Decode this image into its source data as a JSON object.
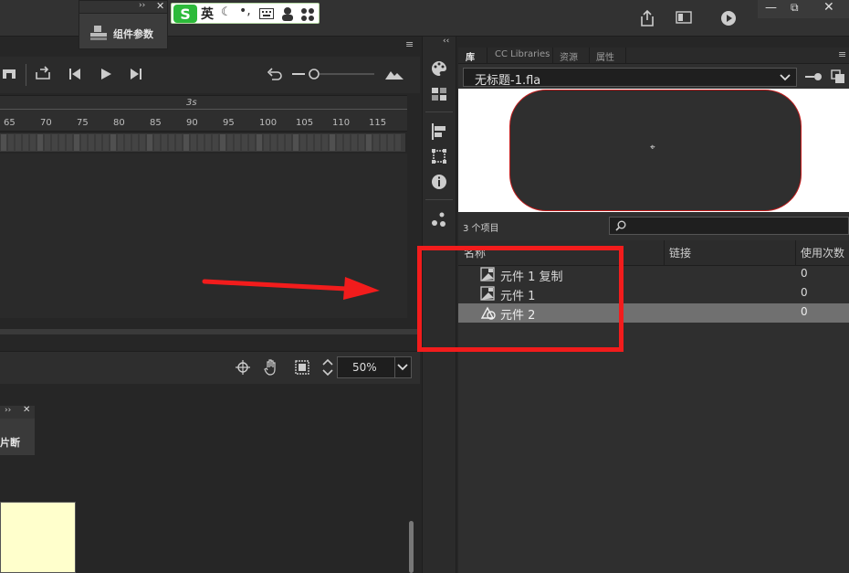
{
  "component_panel": {
    "label": "组件参数"
  },
  "ime": {
    "logo": "S",
    "lang": "英"
  },
  "timeline": {
    "ruler_time": "3s",
    "ruler_numbers": [
      "65",
      "70",
      "75",
      "80",
      "85",
      "90",
      "95",
      "100",
      "105",
      "110",
      "115"
    ]
  },
  "stage": {
    "zoom": "50%"
  },
  "mini_panel": {
    "label": "片断"
  },
  "library": {
    "tabs": [
      "库",
      "CC Libraries",
      "资源",
      "属性"
    ],
    "document": "无标题-1.fla",
    "item_count": "3 个项目",
    "columns": {
      "name": "名称",
      "linkage": "链接",
      "use_count": "使用次数"
    },
    "items": [
      {
        "name": "元件 1 复制",
        "uses": "0",
        "type": "movieclip"
      },
      {
        "name": "元件 1",
        "uses": "0",
        "type": "movieclip"
      },
      {
        "name": "元件 2",
        "uses": "0",
        "type": "graphic"
      }
    ]
  },
  "colors": {
    "annotation_red": "#f21c1c",
    "selected_row": "#707070",
    "preview_bg": "#ffffff"
  }
}
